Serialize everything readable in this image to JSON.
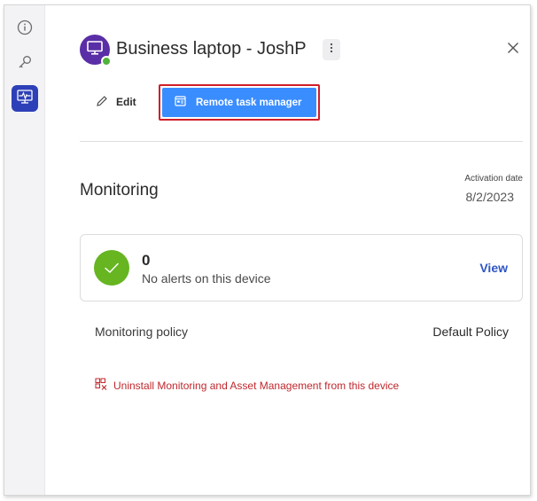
{
  "rail": {
    "items": [
      {
        "icon": "info-icon"
      },
      {
        "icon": "key-icon"
      },
      {
        "icon": "monitor-pulse-icon",
        "active": true
      }
    ]
  },
  "header": {
    "title": "Business laptop - JoshP",
    "avatar_icon": "desktop-icon",
    "status": "online",
    "menu_icon": "kebab-icon",
    "close_icon": "close-icon"
  },
  "actions": {
    "edit_label": "Edit",
    "remote_label": "Remote task manager"
  },
  "monitoring": {
    "section_title": "Monitoring",
    "activation_label": "Activation date",
    "activation_value": "8/2/2023",
    "alerts": {
      "count": "0",
      "message": "No alerts on this device",
      "view_label": "View"
    },
    "policy_label": "Monitoring policy",
    "policy_value": "Default Policy",
    "uninstall_label": "Uninstall Monitoring and Asset Management from this device"
  },
  "colors": {
    "accent": "#3a8dff",
    "highlight_border": "#d11e2a",
    "avatar": "#5a2ea6",
    "success": "#66b521",
    "danger": "#c0272d",
    "link": "#2e55c4"
  }
}
